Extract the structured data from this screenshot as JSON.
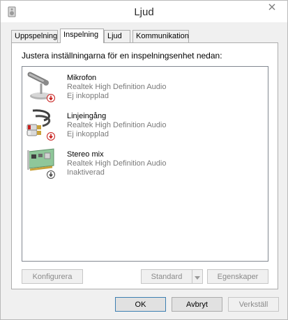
{
  "window": {
    "title": "Ljud"
  },
  "tabs": [
    {
      "label": "Uppspelning",
      "active": false
    },
    {
      "label": "Inspelning",
      "active": true
    },
    {
      "label": "Ljud",
      "active": false
    },
    {
      "label": "Kommunikation",
      "active": false
    }
  ],
  "panel": {
    "instruction": "Justera inställningarna för en inspelningsenhet nedan:"
  },
  "devices": [
    {
      "name": "Mikrofon",
      "driver": "Realtek High Definition Audio",
      "status": "Ej inkopplad",
      "icon": "microphone-icon",
      "status_icon": "unplugged-badge-icon"
    },
    {
      "name": "Linjeingång",
      "driver": "Realtek High Definition Audio",
      "status": "Ej inkopplad",
      "icon": "line-in-cable-icon",
      "status_icon": "unplugged-badge-icon"
    },
    {
      "name": "Stereo mix",
      "driver": "Realtek High Definition Audio",
      "status": "Inaktiverad",
      "icon": "sound-card-icon",
      "status_icon": "disabled-badge-icon"
    }
  ],
  "panel_buttons": {
    "configure": "Konfigurera",
    "default": "Standard",
    "properties": "Egenskaper"
  },
  "dialog_buttons": {
    "ok": "OK",
    "cancel": "Avbryt",
    "apply": "Verkställ"
  },
  "colors": {
    "unplugged_badge": "#c8201e",
    "disabled_badge": "#4a4a4a",
    "default_button_border": "#3c7fb1"
  }
}
